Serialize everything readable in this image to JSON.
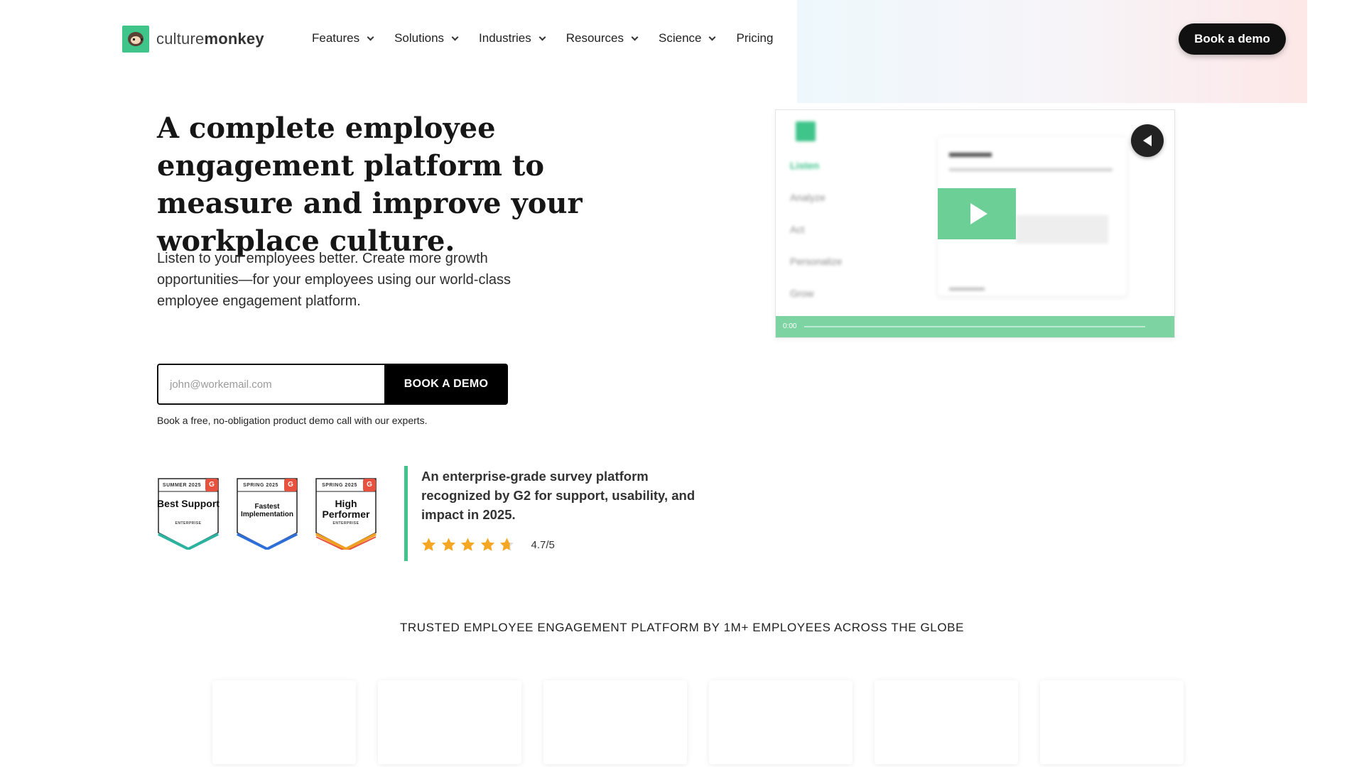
{
  "brand": {
    "name_light": "culture",
    "name_bold": "monkey",
    "accent": "#3fc48a"
  },
  "nav": {
    "items": [
      {
        "label": "Features",
        "dropdown": true
      },
      {
        "label": "Solutions",
        "dropdown": true
      },
      {
        "label": "Industries",
        "dropdown": true
      },
      {
        "label": "Resources",
        "dropdown": true
      },
      {
        "label": "Science",
        "dropdown": true
      },
      {
        "label": "Pricing",
        "dropdown": false
      }
    ],
    "cta_label": "Book a demo"
  },
  "hero": {
    "headline": "A complete employee engagement platform to measure and improve your workplace culture.",
    "subtext": "Listen to your employees better. Create more growth opportunities—for your employees using our world-class employee engagement platform.",
    "email_placeholder": "john@workemail.com",
    "email_value": "",
    "button_label": "BOOK A DEMO",
    "note": "Book a free, no-obligation product demo call with our experts."
  },
  "badges": [
    {
      "season": "SUMMER 2025",
      "title": "Best Support",
      "sub": "ENTERPRISE",
      "color": "#2bb3a0"
    },
    {
      "season": "SPRING 2025",
      "title": "Fastest Implementation",
      "sub": "",
      "color": "#2d6fd6"
    },
    {
      "season": "SPRING 2025",
      "title": "High Performer",
      "sub": "ENTERPRISE",
      "color": "#f0a020"
    }
  ],
  "g2": {
    "text": "An enterprise-grade survey platform recognized by G2 for support, usability, and impact in 2025.",
    "rating": "4.7/5",
    "stars": 4.7,
    "star_color": "#f5a623"
  },
  "video": {
    "menu": [
      "Listen",
      "Analyze",
      "Act",
      "Personalize",
      "Grow"
    ],
    "active_index": 0,
    "time": "0:00",
    "play_icon": "play-icon",
    "mute_icon": "speaker-icon"
  },
  "trust": {
    "heading": "TRUSTED EMPLOYEE ENGAGEMENT PLATFORM BY 1M+ EMPLOYEES ACROSS THE GLOBE",
    "logo_count": 6
  }
}
